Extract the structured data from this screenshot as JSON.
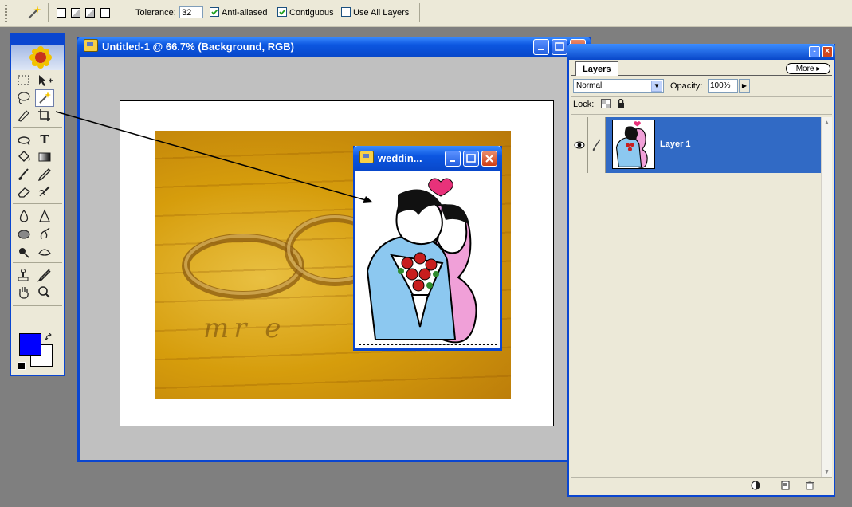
{
  "options_bar": {
    "tolerance_label": "Tolerance:",
    "tolerance_value": "32",
    "anti_aliased_label": "Anti-aliased",
    "anti_aliased_checked": true,
    "contiguous_label": "Contiguous",
    "contiguous_checked": true,
    "use_all_layers_label": "Use All Layers",
    "use_all_layers_checked": false
  },
  "toolbox": {
    "selected_tool": "magic-wand",
    "foreground_color": "#0000ff",
    "background_color": "#ffffff"
  },
  "document": {
    "title": "Untitled-1 @ 66.7% (Background, RGB)",
    "photo_text": "mr  e"
  },
  "wedding_window": {
    "title": "weddin..."
  },
  "layers_panel": {
    "tab_label": "Layers",
    "more_label": "More",
    "blend_mode": "Normal",
    "opacity_label": "Opacity:",
    "opacity_value": "100%",
    "lock_label": "Lock:",
    "layers": [
      {
        "name": "Layer 1",
        "visible": true,
        "selected": true
      }
    ]
  },
  "colors": {
    "xp_blue": "#0a46d0",
    "selection_blue": "#316ac5",
    "panel_bg": "#ece9d8",
    "workspace_gray": "#7f7f7f"
  }
}
